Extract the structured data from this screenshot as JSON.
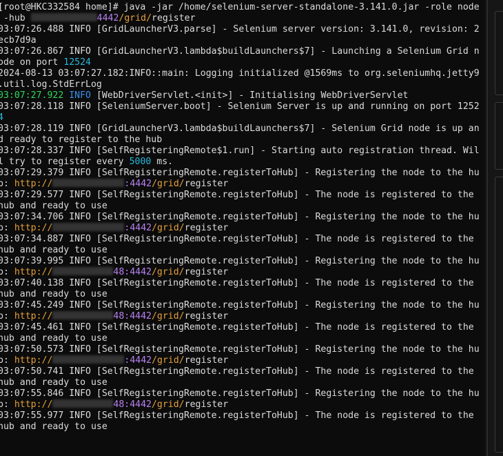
{
  "terminal": {
    "lines": [
      {
        "segments": [
          {
            "t": "[root@HKC332584 home]# java -jar /home/selenium-server-standalone-3.141.0.jar -role node"
          }
        ]
      },
      {
        "segments": [
          {
            "t": " -hub "
          },
          {
            "redact": true,
            "w": 96
          },
          {
            "t": "4442",
            "c": "purple"
          },
          {
            "t": "/grid/",
            "c": "orange"
          },
          {
            "t": "register"
          }
        ]
      },
      {
        "segments": [
          {
            "t": "03:07:26.488 INFO [GridLauncherV3.parse] - Selenium server version: 3.141.0, revision: 2"
          }
        ]
      },
      {
        "segments": [
          {
            "t": "ecb7d9a"
          }
        ]
      },
      {
        "segments": [
          {
            "t": "03:07:26.867 INFO [GridLauncherV3.lambda$buildLaunchers$7] - Launching a Selenium Grid n"
          }
        ]
      },
      {
        "segments": [
          {
            "t": "ode on port "
          },
          {
            "t": "12524",
            "c": "cyan"
          }
        ]
      },
      {
        "segments": [
          {
            "t": "2024-08-13 03:07:27.182:INFO::main: Logging initialized @1569ms to org.seleniumhq.jetty9"
          }
        ]
      },
      {
        "segments": [
          {
            "t": ".util.log.StdErrLog"
          }
        ]
      },
      {
        "segments": [
          {
            "t": "03:07:27.922",
            "c": "green"
          },
          {
            "t": " "
          },
          {
            "t": "INFO",
            "c": "blue"
          },
          {
            "t": " [WebDriverServlet.<init>] - Initialising WebDriverServlet"
          }
        ]
      },
      {
        "segments": [
          {
            "t": "03:07:28.118 INFO [SeleniumServer.boot] - Selenium Server is up and running on port 1252"
          }
        ]
      },
      {
        "segments": [
          {
            "t": "4",
            "c": "cyan"
          }
        ]
      },
      {
        "segments": [
          {
            "t": "03:07:28.119 INFO [GridLauncherV3.lambda$buildLaunchers$7] - Selenium Grid node is up an"
          }
        ]
      },
      {
        "segments": [
          {
            "t": "d ready to register to the hub"
          }
        ]
      },
      {
        "segments": [
          {
            "t": "03:07:28.337 INFO [SelfRegisteringRemote$1.run] - Starting auto registration thread. Wil"
          }
        ]
      },
      {
        "segments": [
          {
            "t": "l try to register every "
          },
          {
            "t": "5000",
            "c": "cyan"
          },
          {
            "t": " ms."
          }
        ]
      },
      {
        "segments": [
          {
            "t": "03:07:29.379 INFO [SelfRegisteringRemote.registerToHub] - Registering the node to the hu"
          }
        ]
      },
      {
        "segments": [
          {
            "t": "b: "
          },
          {
            "t": "http://",
            "c": "orange"
          },
          {
            "redact": true,
            "w": 104
          },
          {
            "t": ":4442",
            "c": "purple"
          },
          {
            "t": "/grid/",
            "c": "orange"
          },
          {
            "t": "register"
          }
        ]
      },
      {
        "segments": [
          {
            "t": "03:07:29.577 INFO [SelfRegisteringRemote.registerToHub] - The node is registered to the"
          }
        ]
      },
      {
        "segments": [
          {
            "t": "hub and ready to use"
          }
        ]
      },
      {
        "segments": [
          {
            "t": "03:07:34.706 INFO [SelfRegisteringRemote.registerToHub] - Registering the node to the hu"
          }
        ]
      },
      {
        "segments": [
          {
            "t": "b: "
          },
          {
            "t": "http://",
            "c": "orange"
          },
          {
            "redact": true,
            "w": 104
          },
          {
            "t": ":4442",
            "c": "purple"
          },
          {
            "t": "/grid/",
            "c": "orange"
          },
          {
            "t": "register"
          }
        ]
      },
      {
        "segments": [
          {
            "t": "03:07:34.887 INFO [SelfRegisteringRemote.registerToHub] - The node is registered to the"
          }
        ]
      },
      {
        "segments": [
          {
            "t": "hub and ready to use"
          }
        ]
      },
      {
        "segments": [
          {
            "t": "03:07:39.995 INFO [SelfRegisteringRemote.registerToHub] - Registering the node to the hu"
          }
        ]
      },
      {
        "segments": [
          {
            "t": "b: "
          },
          {
            "t": "http://",
            "c": "orange"
          },
          {
            "redact": true,
            "w": 88
          },
          {
            "t": "48:4442",
            "c": "purple"
          },
          {
            "t": "/grid/",
            "c": "orange"
          },
          {
            "t": "register"
          }
        ]
      },
      {
        "segments": [
          {
            "t": "03:07:40.138 INFO [SelfRegisteringRemote.registerToHub] - The node is registered to the"
          }
        ]
      },
      {
        "segments": [
          {
            "t": "hub and ready to use"
          }
        ]
      },
      {
        "segments": [
          {
            "t": "03:07:45.249 INFO [SelfRegisteringRemote.registerToHub] - Registering the node to the hu"
          }
        ]
      },
      {
        "segments": [
          {
            "t": "b: "
          },
          {
            "t": "http://",
            "c": "orange"
          },
          {
            "redact": true,
            "w": 88
          },
          {
            "t": "48:4442",
            "c": "purple"
          },
          {
            "t": "/grid/",
            "c": "orange"
          },
          {
            "t": "register"
          }
        ]
      },
      {
        "segments": [
          {
            "t": "03:07:45.461 INFO [SelfRegisteringRemote.registerToHub] - The node is registered to the"
          }
        ]
      },
      {
        "segments": [
          {
            "t": "hub and ready to use"
          }
        ]
      },
      {
        "segments": [
          {
            "t": "03:07:50.573 INFO [SelfRegisteringRemote.registerToHub] - Registering the node to the hu"
          }
        ]
      },
      {
        "segments": [
          {
            "t": "b: "
          },
          {
            "t": "http://",
            "c": "orange"
          },
          {
            "redact": true,
            "w": 104
          },
          {
            "t": ":4442",
            "c": "purple"
          },
          {
            "t": "/grid/",
            "c": "orange"
          },
          {
            "t": "register"
          }
        ]
      },
      {
        "segments": [
          {
            "t": "03:07:50.741 INFO [SelfRegisteringRemote.registerToHub] - The node is registered to the"
          }
        ]
      },
      {
        "segments": [
          {
            "t": "hub and ready to use"
          }
        ]
      },
      {
        "segments": [
          {
            "t": "03:07:55.846 INFO [SelfRegisteringRemote.registerToHub] - Registering the node to the hu"
          }
        ]
      },
      {
        "segments": [
          {
            "t": "b: "
          },
          {
            "t": "http://",
            "c": "orange"
          },
          {
            "redact": true,
            "w": 88
          },
          {
            "t": "48:4442",
            "c": "purple"
          },
          {
            "t": "/grid/",
            "c": "orange"
          },
          {
            "t": "register"
          }
        ]
      },
      {
        "segments": [
          {
            "t": "03:07:55.977 INFO [SelfRegisteringRemote.registerToHub] - The node is registered to the"
          }
        ]
      },
      {
        "segments": [
          {
            "t": "hub and ready to use"
          }
        ]
      }
    ]
  },
  "colors": {
    "background": "#0c0c0c",
    "text": "#dcdcdc",
    "green": "#2fd75c",
    "blue": "#3b8eea",
    "cyan": "#29b8db",
    "orange": "#e5a03c",
    "purple": "#b882f2"
  }
}
